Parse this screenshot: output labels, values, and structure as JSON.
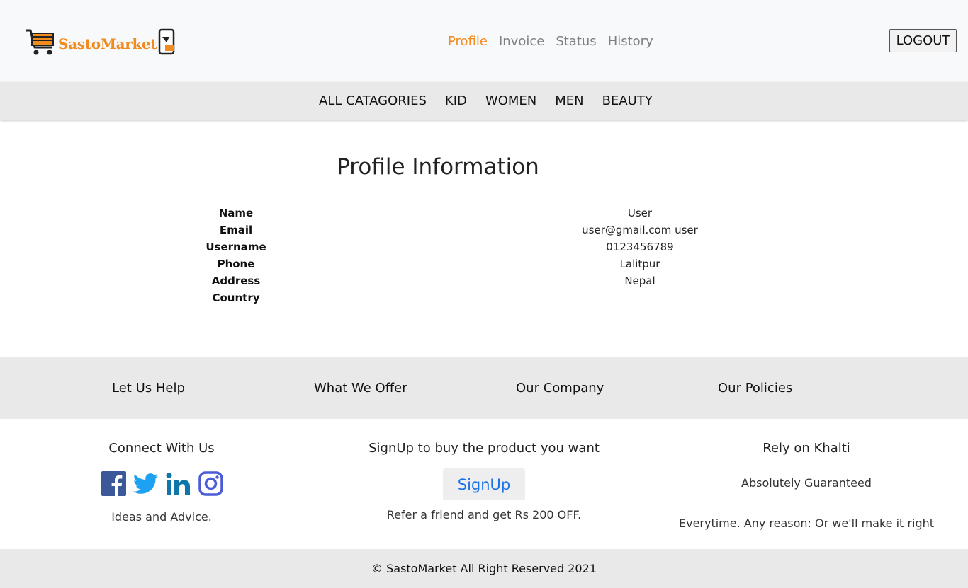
{
  "brand": {
    "name": "SastoMarket",
    "accent_color": "#f18a1f",
    "icons": [
      "shopping-cart-icon",
      "phone-icon"
    ]
  },
  "top_nav": {
    "items": [
      "Profile",
      "Invoice",
      "Status",
      "History"
    ],
    "active": "Profile",
    "logout_label": "LOGOUT"
  },
  "category_nav": {
    "items": [
      "ALL CATAGORIES",
      "KID",
      "WOMEN",
      "MEN",
      "BEAUTY"
    ]
  },
  "profile": {
    "title": "Profile Information",
    "labels": [
      "Name",
      "Email",
      "Username",
      "Phone",
      "Address",
      "Country"
    ],
    "values": [
      "User",
      "user@gmail.com user",
      "0123456789",
      "Lalitpur",
      "Nepal"
    ]
  },
  "footer_links": [
    "Let Us Help",
    "What We Offer",
    "Our Company",
    "Our Policies"
  ],
  "connect": {
    "title": "Connect With Us",
    "icons": [
      "facebook-icon",
      "twitter-icon",
      "linkedin-icon",
      "instagram-icon"
    ],
    "tagline": "Ideas and Advice."
  },
  "signup": {
    "title": "SignUp to buy the product you want",
    "button_label": "SignUp",
    "note": "Refer a friend and get Rs 200 OFF."
  },
  "khalti": {
    "title": "Rely on Khalti",
    "line1": "Absolutely Guaranteed",
    "line2": "Everytime. Any reason: Or we'll make it right"
  },
  "copyright": "© SastoMarket All Right Reserved 2021"
}
